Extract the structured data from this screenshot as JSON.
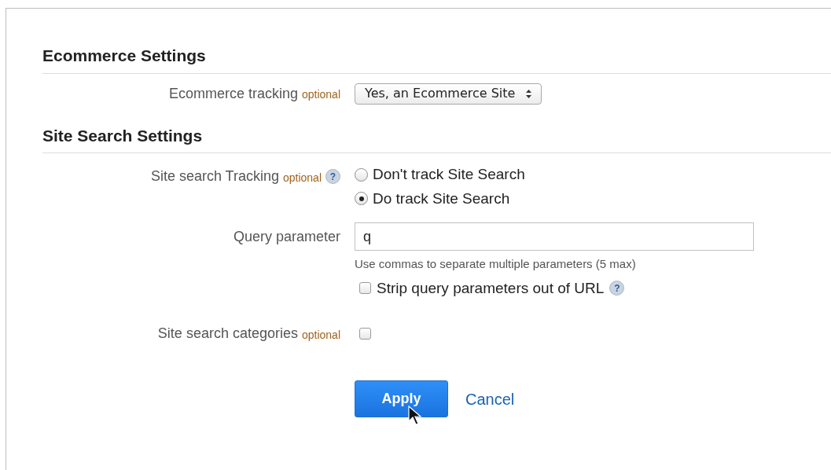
{
  "sections": [
    {
      "title": "Ecommerce Settings",
      "rows": [
        {
          "kind": "select",
          "label": "Ecommerce tracking",
          "optional": "optional",
          "value": "Yes, an Ecommerce Site"
        }
      ]
    },
    {
      "title": "Site Search Settings",
      "rows": [
        {
          "kind": "radio",
          "label": "Site search Tracking",
          "optional": "optional",
          "help": "?",
          "options": [
            {
              "label": "Don't track Site Search",
              "selected": false
            },
            {
              "label": "Do track Site Search",
              "selected": true
            }
          ]
        },
        {
          "kind": "text",
          "label": "Query parameter",
          "value": "q",
          "hint": "Use commas to separate multiple parameters (5 max)",
          "checkbox": {
            "label": "Strip query parameters out of URL",
            "checked": false,
            "help": "?"
          }
        },
        {
          "kind": "checkbox",
          "label": "Site search categories",
          "optional": "optional",
          "checked": false
        }
      ]
    }
  ],
  "buttons": {
    "apply": "Apply",
    "cancel": "Cancel"
  }
}
